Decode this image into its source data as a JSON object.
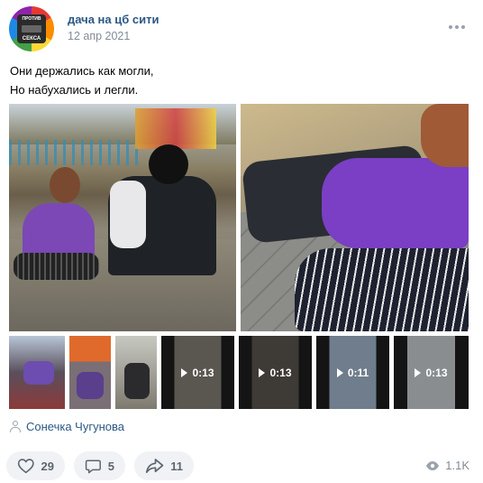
{
  "post": {
    "author": "дача на цб сити",
    "date": "12 апр 2021",
    "avatar": {
      "top_text": "ПРОТИВ",
      "bottom_text": "СЕКСА"
    },
    "text_line1": "Они держались как могли,",
    "text_line2": "Но набухались и легли.",
    "signer": "Сонечка Чугунова"
  },
  "media": {
    "videos": [
      {
        "duration": "0:13"
      },
      {
        "duration": "0:13"
      },
      {
        "duration": "0:11"
      },
      {
        "duration": "0:13"
      }
    ]
  },
  "actions": {
    "likes": "29",
    "comments": "5",
    "shares": "11",
    "views": "1.1K"
  },
  "icons": [
    "more-icon",
    "user-icon",
    "heart-icon",
    "comment-icon",
    "share-icon",
    "eye-icon",
    "play-icon"
  ],
  "colors": {
    "link": "#2a5885",
    "secondary": "#818c99",
    "pill_bg": "#f0f2f5"
  }
}
